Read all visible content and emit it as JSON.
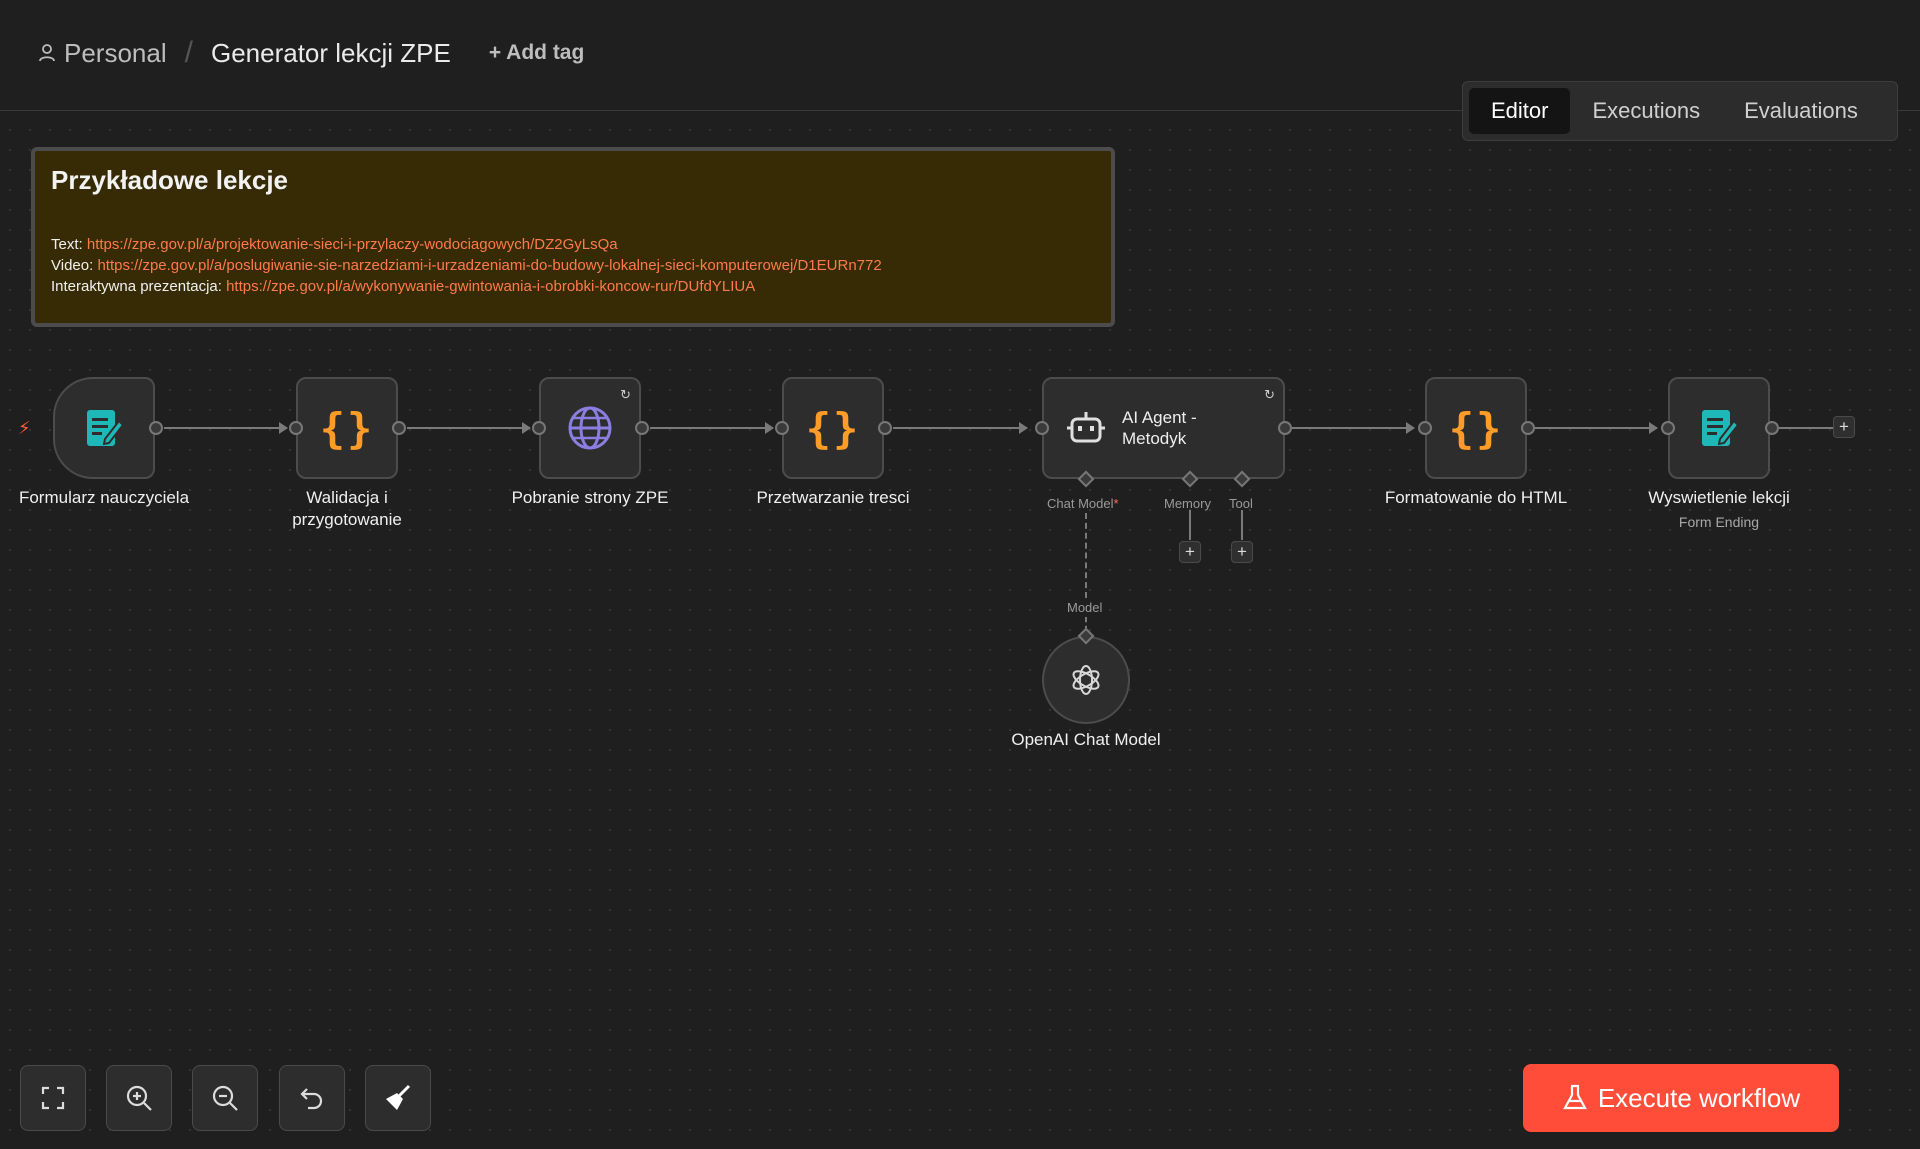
{
  "header": {
    "breadcrumb_personal": "Personal",
    "workflow_title": "Generator lekcji ZPE",
    "add_tag": "+ Add tag"
  },
  "tabs": [
    {
      "label": "Editor",
      "active": true
    },
    {
      "label": "Executions",
      "active": false
    },
    {
      "label": "Evaluations",
      "active": false
    }
  ],
  "sticky": {
    "title": "Przykładowe lekcje",
    "lines": [
      {
        "prefix": "Text: ",
        "url": "https://zpe.gov.pl/a/projektowanie-sieci-i-przylaczy-wodociagowych/DZ2GyLsQa"
      },
      {
        "prefix": "Video: ",
        "url": "https://zpe.gov.pl/a/poslugiwanie-sie-narzedziami-i-urzadzeniami-do-budowy-lokalnej-sieci-komputerowej/D1EURn772"
      },
      {
        "prefix": "Interaktywna prezentacja: ",
        "url": "https://zpe.gov.pl/a/wykonywanie-gwintowania-i-obrobki-koncow-rur/DUfdYLIUA"
      }
    ]
  },
  "nodes": {
    "form_trigger": {
      "label": "Formularz nauczyciela",
      "icon": "form-icon"
    },
    "validation": {
      "label": "Walidacja i przygotowanie",
      "label_line1": "Walidacja i",
      "label_line2": "przygotowanie",
      "icon": "code-braces-icon"
    },
    "fetch_page": {
      "label": "Pobranie strony ZPE",
      "icon": "globe-icon"
    },
    "processing": {
      "label": "Przetwarzanie tresci",
      "icon": "code-braces-icon"
    },
    "ai_agent": {
      "label_line1": "AI Agent -",
      "label_line2": "Metodyk",
      "icon": "robot-icon"
    },
    "formatting": {
      "label": "Formatowanie do HTML",
      "icon": "code-braces-icon"
    },
    "display": {
      "label": "Wyswietlenie lekcji",
      "sublabel": "Form Ending",
      "icon": "form-icon"
    },
    "openai": {
      "label": "OpenAI Chat Model",
      "icon": "openai-icon"
    }
  },
  "agent_ports": {
    "chat_model": "Chat Model",
    "chat_model_required": "*",
    "memory": "Memory",
    "tool": "Tool",
    "model": "Model"
  },
  "code_glyph": "{}",
  "plus_glyph": "+",
  "controls": [
    {
      "name": "fit-view",
      "icon": "fit-view-icon"
    },
    {
      "name": "zoom-in",
      "icon": "zoom-in-icon"
    },
    {
      "name": "zoom-out",
      "icon": "zoom-out-icon"
    },
    {
      "name": "undo",
      "icon": "undo-icon"
    },
    {
      "name": "clean-up",
      "icon": "broom-icon"
    }
  ],
  "execute_button": "Execute workflow",
  "colors": {
    "accent": "#ff4d3a",
    "code_orange": "#ff9b27",
    "form_teal": "#1fb8b8",
    "globe_purple": "#8b7ee0",
    "sticky_bg": "#362b05",
    "link": "#ff7a4a"
  }
}
